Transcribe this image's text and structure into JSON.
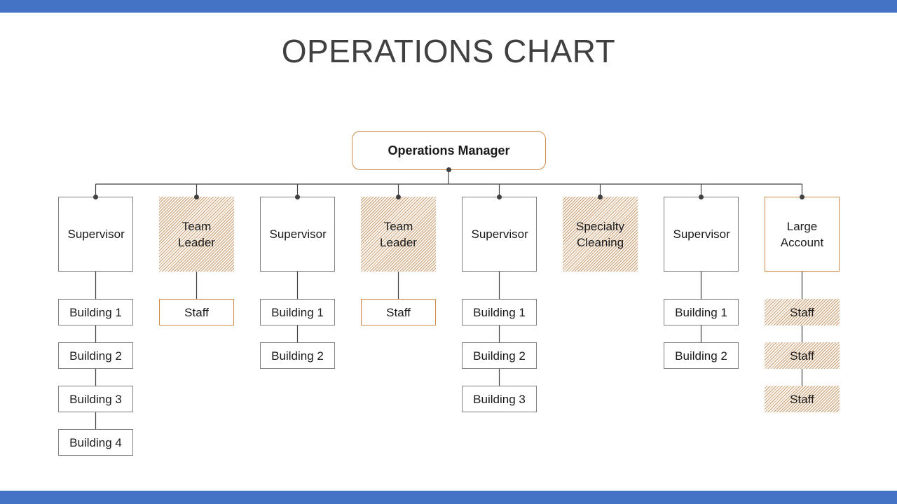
{
  "title": "OPERATIONS CHART",
  "colors": {
    "accent_bar": "#4472c4",
    "orange_border": "#d08a4a",
    "gray_border": "#7f7f7f",
    "line": "#404040"
  },
  "root": {
    "label": "Operations Manager"
  },
  "columns": [
    {
      "head": "Supervisor",
      "style": "plain",
      "children": [
        "Building 1",
        "Building 2",
        "Building 3",
        "Building 4"
      ],
      "child_style": "plain"
    },
    {
      "head": "Team Leader",
      "style": "hatched",
      "children": [
        "Staff"
      ],
      "child_style": "orange"
    },
    {
      "head": "Supervisor",
      "style": "plain",
      "children": [
        "Building 1",
        "Building 2"
      ],
      "child_style": "plain"
    },
    {
      "head": "Team Leader",
      "style": "hatched",
      "children": [
        "Staff"
      ],
      "child_style": "orange"
    },
    {
      "head": "Supervisor",
      "style": "plain",
      "children": [
        "Building 1",
        "Building 2",
        "Building 3"
      ],
      "child_style": "plain"
    },
    {
      "head": "Specialty Cleaning",
      "style": "hatched",
      "children": [],
      "child_style": "plain"
    },
    {
      "head": "Supervisor",
      "style": "plain",
      "children": [
        "Building 1",
        "Building 2"
      ],
      "child_style": "plain"
    },
    {
      "head": "Large Account",
      "style": "orange",
      "children": [
        "Staff",
        "Staff",
        "Staff"
      ],
      "child_style": "hatched"
    }
  ]
}
